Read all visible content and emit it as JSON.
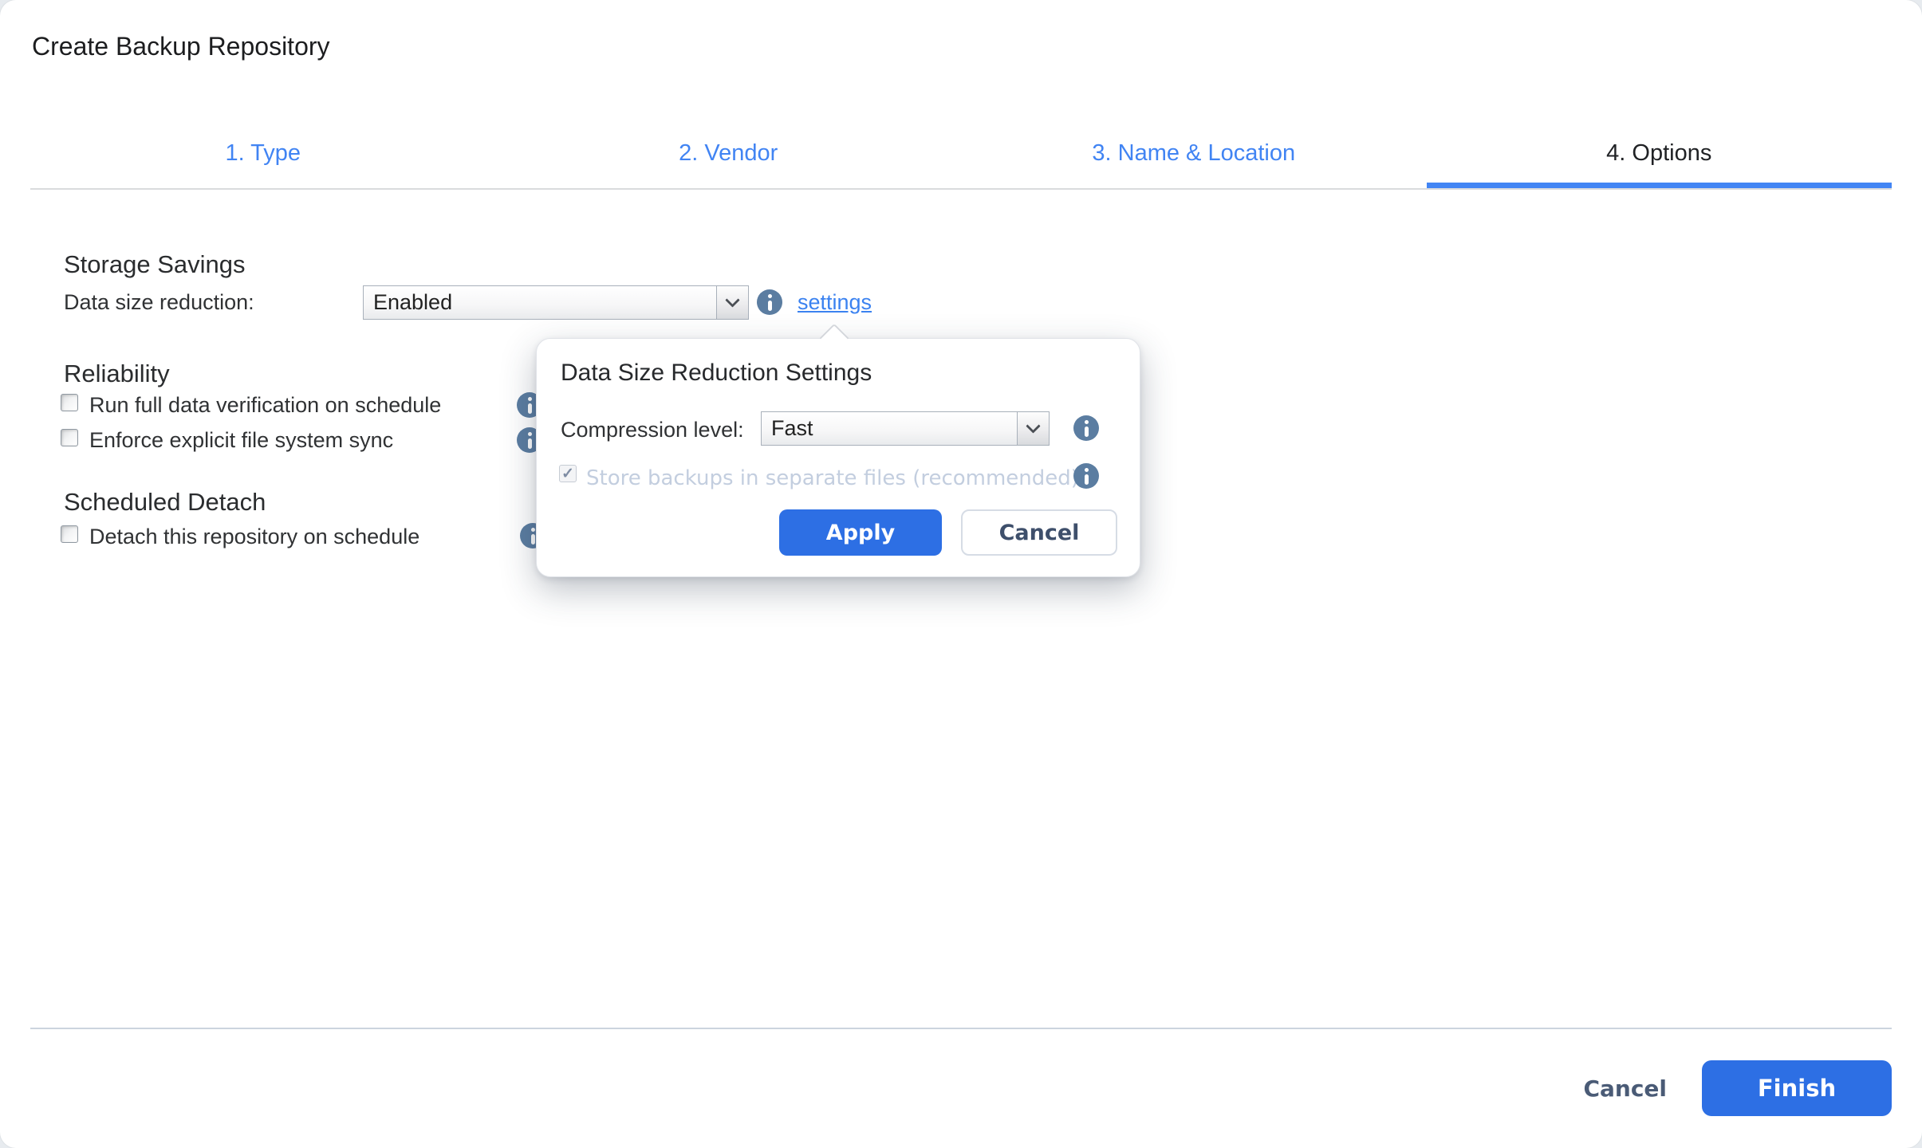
{
  "window": {
    "title": "Create Backup Repository"
  },
  "tabs": [
    {
      "label": "1. Type",
      "active": false
    },
    {
      "label": "2. Vendor",
      "active": false
    },
    {
      "label": "3. Name & Location",
      "active": false
    },
    {
      "label": "4. Options",
      "active": true
    }
  ],
  "storage_savings": {
    "heading": "Storage Savings",
    "reduction_label": "Data size reduction:",
    "reduction_value": "Enabled",
    "settings_link": "settings"
  },
  "reliability": {
    "heading": "Reliability",
    "items": [
      {
        "label": "Run full data verification on schedule",
        "checked": false
      },
      {
        "label": "Enforce explicit file system sync",
        "checked": false
      }
    ]
  },
  "scheduled_detach": {
    "heading": "Scheduled Detach",
    "items": [
      {
        "label": "Detach this repository on schedule",
        "checked": false
      }
    ]
  },
  "popover": {
    "title": "Data Size Reduction Settings",
    "compression_label": "Compression level:",
    "compression_value": "Fast",
    "store_backups_label": "Store backups in separate files (recommended)",
    "store_backups_checked": true,
    "store_backups_disabled": true,
    "apply_label": "Apply",
    "cancel_label": "Cancel"
  },
  "footer": {
    "cancel_label": "Cancel",
    "finish_label": "Finish"
  },
  "colors": {
    "tab_blue": "#4285f4",
    "button_blue": "#2d6fe4",
    "link_blue": "#3b82f0",
    "info_icon": "#5b7da1",
    "disabled_text": "#c3cedf",
    "footer_text": "#4a5b76"
  }
}
